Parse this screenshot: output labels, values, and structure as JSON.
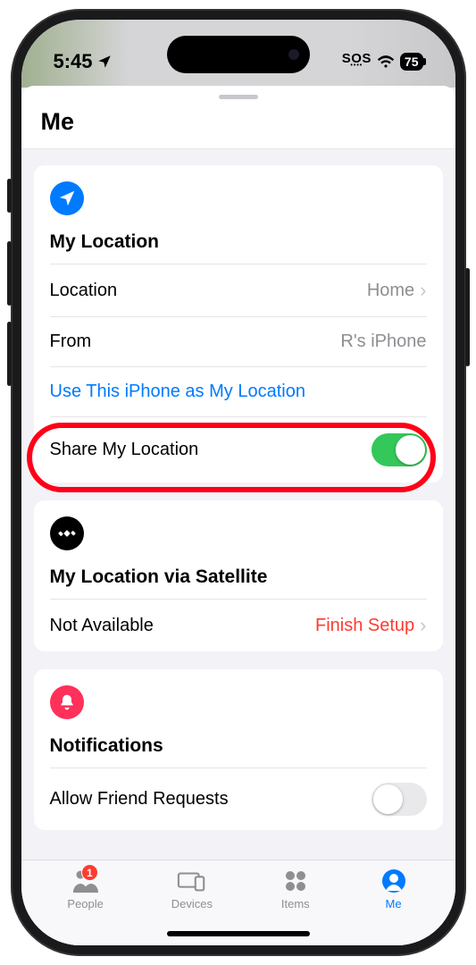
{
  "status": {
    "time": "5:45",
    "sos": "SOS",
    "battery": "75"
  },
  "header": {
    "title": "Me"
  },
  "my_location": {
    "group_title": "My Location",
    "location_label": "Location",
    "location_value": "Home",
    "from_label": "From",
    "from_value": "R's iPhone",
    "use_link": "Use This iPhone as My Location",
    "share_label": "Share My Location",
    "share_on": true
  },
  "satellite": {
    "group_title": "My Location via Satellite",
    "status_label": "Not Available",
    "action": "Finish Setup"
  },
  "notifications": {
    "group_title": "Notifications",
    "allow_label": "Allow Friend Requests",
    "allow_on": false
  },
  "tabs": {
    "people": "People",
    "people_badge": "1",
    "devices": "Devices",
    "items": "Items",
    "me": "Me"
  }
}
